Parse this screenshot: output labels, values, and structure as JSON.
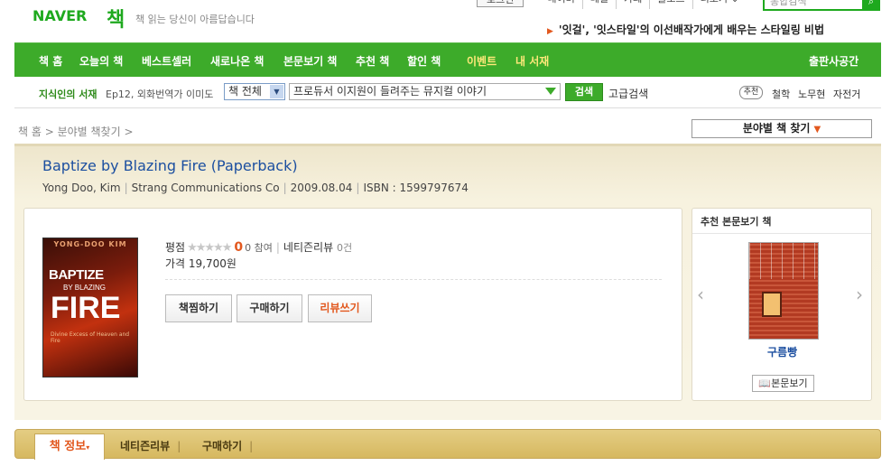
{
  "header": {
    "logo": "NAVER",
    "logo_book": "책",
    "slogan": "책 읽는 당신이 아름답습니다",
    "login_label": "로그인",
    "top_links": [
      "네이버",
      "메일",
      "카페",
      "블로그",
      "더보기 ⌄"
    ],
    "search_placeholder": "통합검색",
    "promo_text": "'잇걸', '잇스타일'의 이선배작가에게 배우는 스타일링 비법"
  },
  "nav": {
    "items": [
      "책 홈",
      "오늘의 책",
      "베스트셀러",
      "새로나온 책",
      "본문보기 책",
      "추천 책",
      "할인 책",
      "이벤트",
      "내 서재"
    ],
    "right_item": "출판사공간"
  },
  "subnav": {
    "intel_title": "지식인의 서재",
    "intel_sub": "Ep12, 외화번역가 이미도",
    "category_select": "책 전체",
    "search_value": "프로듀서 이지원이 들려주는 뮤지컬 이야기",
    "search_button": "검색",
    "advanced_search": "고급검색",
    "recommend_badge": "추천",
    "recommend_keywords": [
      "철학",
      "노무현",
      "자전거"
    ]
  },
  "breadcrumb": "책 홈 > 분야별 책찾기 >",
  "find_by_field": "분야별 책 찾기",
  "book": {
    "title": "Baptize by Blazing Fire (Paperback)",
    "author": "Yong Doo, Kim",
    "publisher": "Strang Communications Co",
    "date": "2009.08.04",
    "isbn": "ISBN : 1599797674",
    "cover": {
      "author_line": "YONG-DOO KIM",
      "title_line1": "BAPTIZE",
      "title_line2": "BY BLAZING",
      "title_line3": "FIRE",
      "subtitle": "Divine Excess of Heaven and Fire"
    },
    "rating_label": "평점",
    "rating_score": "0",
    "participants": "0 참여",
    "review_label": "네티즌리뷰",
    "review_count": "0건",
    "price": "가격 19,700원",
    "actions": [
      "책찜하기",
      "구매하기",
      "리뷰쓰기"
    ]
  },
  "side": {
    "header": "추천 본문보기 책",
    "book_name": "구름빵",
    "preview_button": "본문보기"
  },
  "tabs": {
    "active": "책 정보",
    "items": [
      "네티즌리뷰",
      "구매하기"
    ]
  },
  "colors": {
    "brand_green": "#3dab2a",
    "link_blue": "#1c4fa0",
    "accent_orange": "#e2581e"
  }
}
